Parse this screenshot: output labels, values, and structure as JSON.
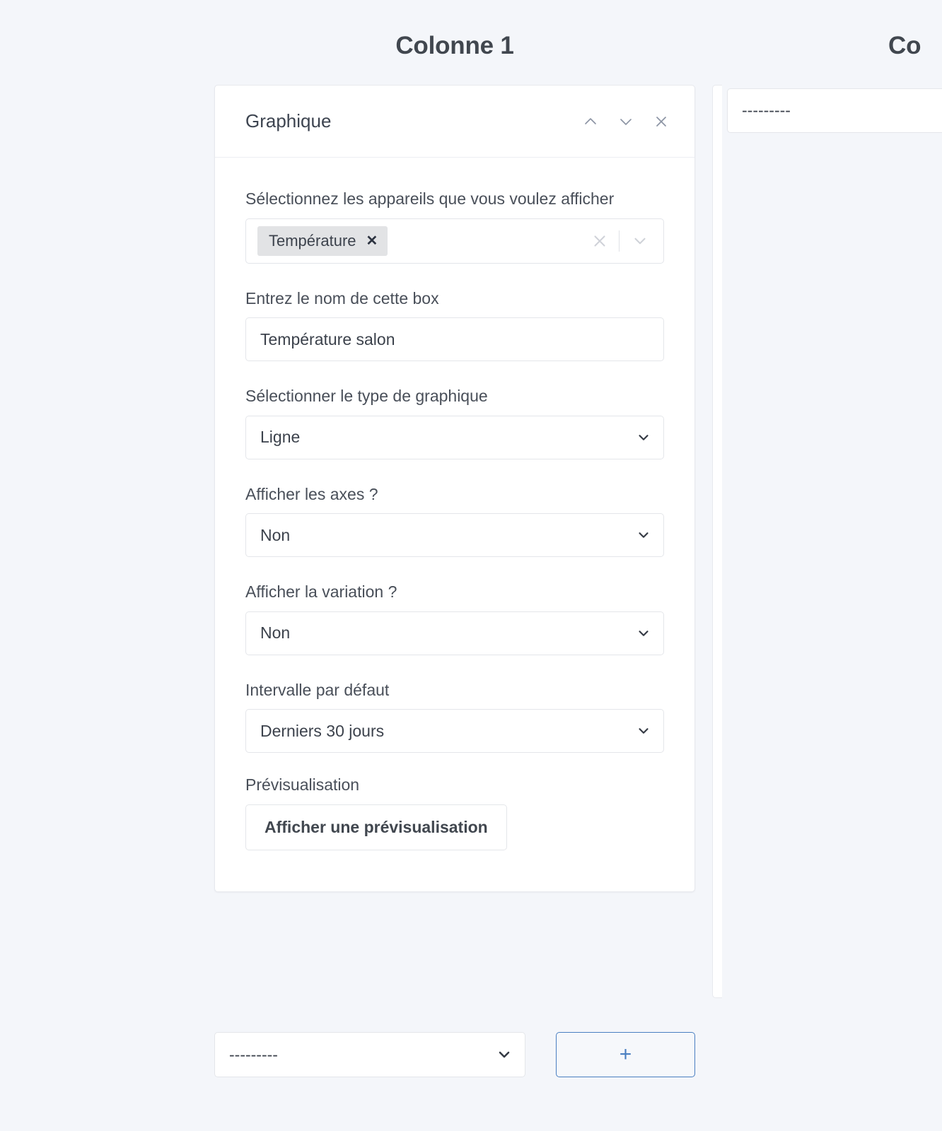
{
  "columns": [
    {
      "title": "Colonne 1"
    },
    {
      "title": "Co"
    }
  ],
  "card": {
    "title": "Graphique",
    "header_icons": {
      "move_up": "chevron-up-icon",
      "move_down": "chevron-down-icon",
      "remove": "close-icon"
    },
    "fields": {
      "devices": {
        "label": "Sélectionnez les appareils que vous voulez afficher",
        "tags": [
          {
            "label": "Température",
            "remove": "✕"
          }
        ],
        "clear_icon": "clear-icon",
        "dropdown_icon": "chevron-down-icon"
      },
      "box_name": {
        "label": "Entrez le nom de cette box",
        "value": "Température salon",
        "placeholder": ""
      },
      "chart_type": {
        "label": "Sélectionner le type de graphique",
        "value": "Ligne"
      },
      "show_axes": {
        "label": "Afficher les axes ?",
        "value": "Non"
      },
      "show_variation": {
        "label": "Afficher la variation ?",
        "value": "Non"
      },
      "default_interval": {
        "label": "Intervalle par défaut",
        "value": "Derniers 30 jours"
      },
      "preview": {
        "label": "Prévisualisation",
        "button_label": "Afficher une prévisualisation"
      }
    }
  },
  "bottom_bar": {
    "select_value": "---------",
    "add_label": "+"
  },
  "column2": {
    "select_value": "---------"
  },
  "colors": {
    "page_background": "#f4f6fa",
    "card_background": "#ffffff",
    "border": "#e4e6ea",
    "text_primary": "#3c424c",
    "text_title": "#41474f",
    "accent_blue": "#4a7fc1",
    "tag_background": "#e2e3e5",
    "icon_muted": "#8b93a3"
  }
}
